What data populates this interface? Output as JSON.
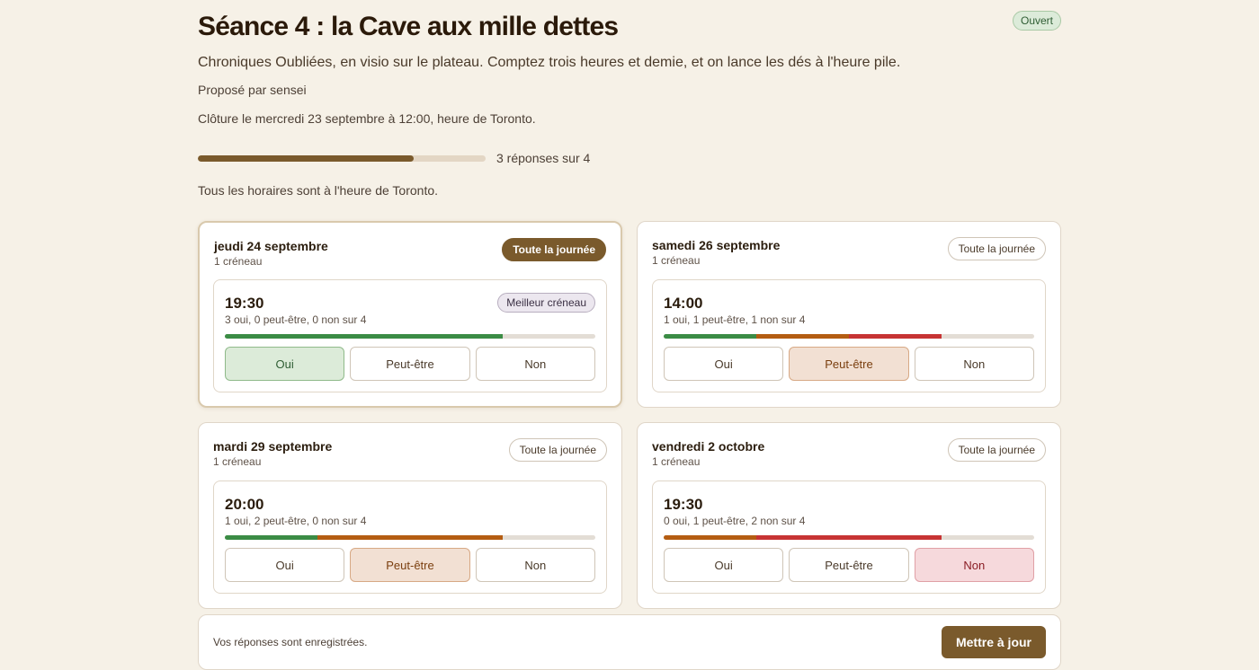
{
  "poll": {
    "title": "Séance 4 : la Cave aux mille dettes",
    "status": "Ouvert",
    "description": "Chroniques Oubliées, en visio sur le plateau. Comptez trois heures et demie, et on lance les dés à l'heure pile.",
    "proposer": "Proposé par sensei",
    "deadline": "Clôture le mercredi 23 septembre à 12:00, heure de Toronto.",
    "progress_text": "3 réponses sur 4",
    "progress_fraction": 0.75,
    "timezone_note": "Tous les horaires sont à l'heure de Toronto."
  },
  "choice_labels": {
    "yes": "Oui",
    "maybe": "Peut-être",
    "no": "Non"
  },
  "allday_label": "Toute la journée",
  "best_label": "Meilleur créneau",
  "days": [
    {
      "date": "jeudi 24 septembre",
      "count": "1 créneau",
      "allday_active": true,
      "slot": {
        "time": "19:30",
        "tally": "3 oui, 0 peut-être, 0 non sur 4",
        "best": true,
        "yes": 3,
        "maybe": 0,
        "no": 0,
        "total": 4,
        "selected": "yes"
      }
    },
    {
      "date": "samedi 26 septembre",
      "count": "1 créneau",
      "allday_active": false,
      "slot": {
        "time": "14:00",
        "tally": "1 oui, 1 peut-être, 1 non sur 4",
        "best": false,
        "yes": 1,
        "maybe": 1,
        "no": 1,
        "total": 4,
        "selected": "maybe"
      }
    },
    {
      "date": "mardi 29 septembre",
      "count": "1 créneau",
      "allday_active": false,
      "slot": {
        "time": "20:00",
        "tally": "1 oui, 2 peut-être, 0 non sur 4",
        "best": false,
        "yes": 1,
        "maybe": 2,
        "no": 0,
        "total": 4,
        "selected": "maybe"
      }
    },
    {
      "date": "vendredi 2 octobre",
      "count": "1 créneau",
      "allday_active": false,
      "slot": {
        "time": "19:30",
        "tally": "0 oui, 1 peut-être, 2 non sur 4",
        "best": false,
        "yes": 0,
        "maybe": 1,
        "no": 2,
        "total": 4,
        "selected": "no"
      }
    }
  ],
  "footer": {
    "message": "Vos réponses sont enregistrées.",
    "update_label": "Mettre à jour"
  },
  "colors": {
    "accent": "#7a5a2c",
    "yes": "#3b8c45",
    "maybe": "#b45d12",
    "no": "#c73434",
    "background": "#f6f1e7"
  }
}
